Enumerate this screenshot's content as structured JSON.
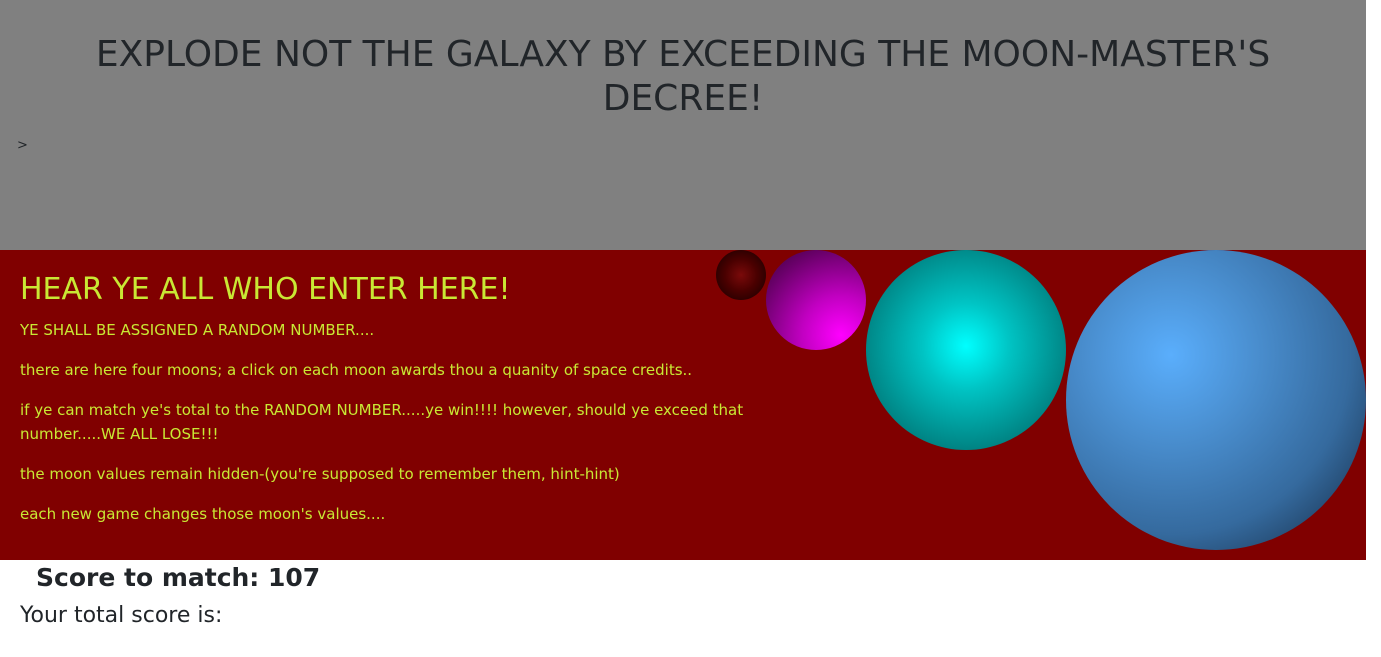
{
  "header": {
    "title": "EXPLODE NOT THE GALAXY BY EXCEEDING THE MOON-MASTER'S DECREE!",
    "caret": ">"
  },
  "rules": {
    "heading": "HEAR YE ALL WHO ENTER HERE!",
    "paragraphs": [
      "YE SHALL BE ASSIGNED A RANDOM NUMBER....",
      "there are here four moons; a click on each moon awards thou a quanity of space credits..",
      "if ye can match ye's total to the RANDOM NUMBER.....ye win!!!! however, should ye exceed that number.....WE ALL LOSE!!!",
      "the moon values remain hidden-(you're supposed to remember them, hint-hint)",
      "each new game changes those moon's values...."
    ]
  },
  "moons": [
    {
      "name": "moon-1",
      "color": "#4a0000"
    },
    {
      "name": "moon-2",
      "color": "#ff00ff"
    },
    {
      "name": "moon-3",
      "color": "#00ffff"
    },
    {
      "name": "moon-4",
      "color": "#4a8fd0"
    }
  ],
  "score": {
    "match_text": "Score to match: 107",
    "total_text": "Your total score is:"
  },
  "colors": {
    "header_bg": "#808080",
    "panel_bg": "#800000",
    "rules_text": "#c9e834"
  }
}
